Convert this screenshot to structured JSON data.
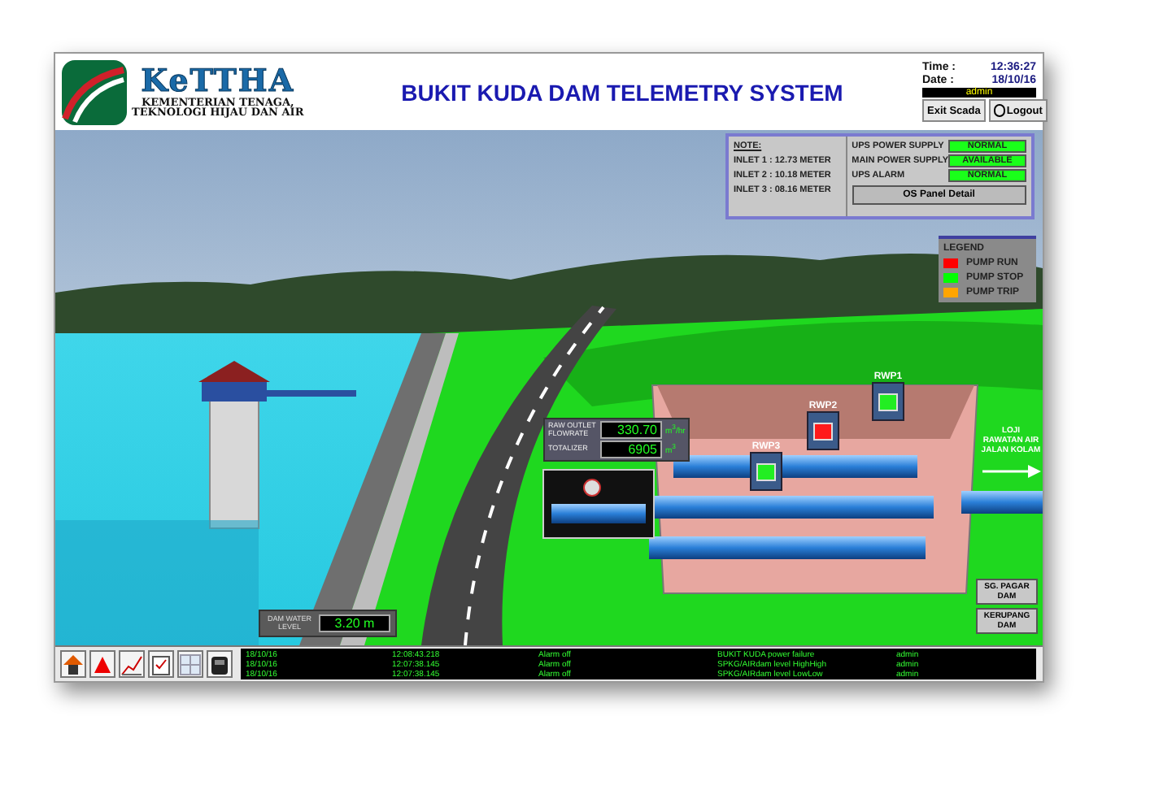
{
  "logo": {
    "name": "KeTTHA",
    "subtitle_1": "KEMENTERIAN TENAGA,",
    "subtitle_2": "TEKNOLOGI HIJAU DAN AIR"
  },
  "title": "BUKIT KUDA DAM TELEMETRY SYSTEM",
  "clock": {
    "time_label": "Time :",
    "time": "12:36:27",
    "date_label": "Date :",
    "date": "18/10/16",
    "user": "admin"
  },
  "header_buttons": [
    {
      "kind": "text",
      "label": "Exit Scada"
    },
    {
      "kind": "icon",
      "label": "Logout"
    }
  ],
  "note": {
    "heading": "NOTE:",
    "lines": [
      "INLET 1 : 12.73 METER",
      "INLET 2 : 10.18 METER",
      "INLET 3 : 08.16 METER"
    ]
  },
  "status": [
    {
      "label": "UPS POWER SUPPLY",
      "value": "NORMAL"
    },
    {
      "label": "MAIN POWER SUPPLY",
      "value": "AVAILABLE"
    },
    {
      "label": "UPS ALARM",
      "value": "NORMAL"
    }
  ],
  "panel_button": "OS Panel Detail",
  "legend": {
    "heading": "LEGEND",
    "items": [
      {
        "label": "PUMP RUN",
        "color": "#ff0000"
      },
      {
        "label": "PUMP STOP",
        "color": "#00ff00"
      },
      {
        "label": "PUMP TRIP",
        "color": "#ffa500"
      }
    ]
  },
  "flow": [
    {
      "label": "RAW OUTLET FLOWRATE",
      "value": "330.70",
      "unit": "m$^{3}$/hr"
    },
    {
      "label": "TOTALIZER",
      "value": "6905",
      "unit": "m$^{3}$"
    }
  ],
  "pumps": [
    {
      "name": "RWP1",
      "running": false
    },
    {
      "name": "RWP2",
      "running": true
    },
    {
      "name": "RWP3",
      "running": false
    }
  ],
  "destination": "LOJI RAWATAN AIR JALAN KOLAM",
  "water_level": {
    "label": "DAM WATER LEVEL",
    "value": "3.20",
    "unit": "m"
  },
  "nav_buttons": [
    "SG. PAGAR DAM",
    "KERUPANG DAM"
  ],
  "alarms": [
    {
      "date": "18/10/16",
      "time": "12:08:43.218",
      "event": "Alarm off",
      "description": "BUKIT KUDA power failure",
      "user": "admin"
    },
    {
      "date": "18/10/16",
      "time": "12:07:38.145",
      "event": "Alarm off",
      "description": "SPKG/AIRdam level HighHigh",
      "user": "admin"
    },
    {
      "date": "18/10/16",
      "time": "12:07:38.145",
      "event": "Alarm off",
      "description": "SPKG/AIRdam level LowLow",
      "user": "admin"
    }
  ]
}
